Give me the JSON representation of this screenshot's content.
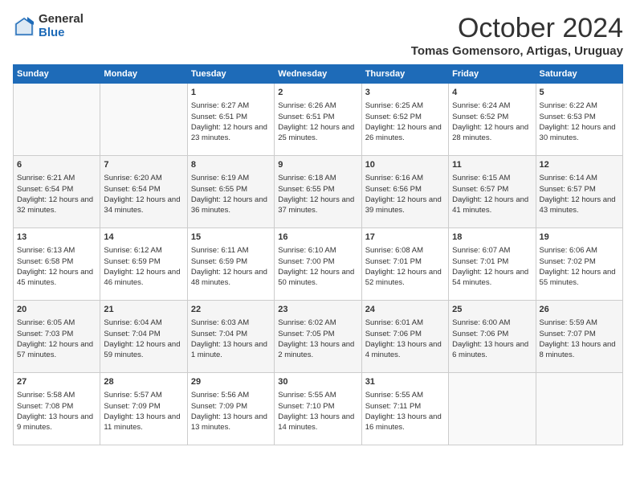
{
  "logo": {
    "general": "General",
    "blue": "Blue"
  },
  "title": "October 2024",
  "location": "Tomas Gomensoro, Artigas, Uruguay",
  "headers": [
    "Sunday",
    "Monday",
    "Tuesday",
    "Wednesday",
    "Thursday",
    "Friday",
    "Saturday"
  ],
  "weeks": [
    [
      {
        "day": "",
        "content": ""
      },
      {
        "day": "",
        "content": ""
      },
      {
        "day": "1",
        "content": "Sunrise: 6:27 AM\nSunset: 6:51 PM\nDaylight: 12 hours and 23 minutes."
      },
      {
        "day": "2",
        "content": "Sunrise: 6:26 AM\nSunset: 6:51 PM\nDaylight: 12 hours and 25 minutes."
      },
      {
        "day": "3",
        "content": "Sunrise: 6:25 AM\nSunset: 6:52 PM\nDaylight: 12 hours and 26 minutes."
      },
      {
        "day": "4",
        "content": "Sunrise: 6:24 AM\nSunset: 6:52 PM\nDaylight: 12 hours and 28 minutes."
      },
      {
        "day": "5",
        "content": "Sunrise: 6:22 AM\nSunset: 6:53 PM\nDaylight: 12 hours and 30 minutes."
      }
    ],
    [
      {
        "day": "6",
        "content": "Sunrise: 6:21 AM\nSunset: 6:54 PM\nDaylight: 12 hours and 32 minutes."
      },
      {
        "day": "7",
        "content": "Sunrise: 6:20 AM\nSunset: 6:54 PM\nDaylight: 12 hours and 34 minutes."
      },
      {
        "day": "8",
        "content": "Sunrise: 6:19 AM\nSunset: 6:55 PM\nDaylight: 12 hours and 36 minutes."
      },
      {
        "day": "9",
        "content": "Sunrise: 6:18 AM\nSunset: 6:55 PM\nDaylight: 12 hours and 37 minutes."
      },
      {
        "day": "10",
        "content": "Sunrise: 6:16 AM\nSunset: 6:56 PM\nDaylight: 12 hours and 39 minutes."
      },
      {
        "day": "11",
        "content": "Sunrise: 6:15 AM\nSunset: 6:57 PM\nDaylight: 12 hours and 41 minutes."
      },
      {
        "day": "12",
        "content": "Sunrise: 6:14 AM\nSunset: 6:57 PM\nDaylight: 12 hours and 43 minutes."
      }
    ],
    [
      {
        "day": "13",
        "content": "Sunrise: 6:13 AM\nSunset: 6:58 PM\nDaylight: 12 hours and 45 minutes."
      },
      {
        "day": "14",
        "content": "Sunrise: 6:12 AM\nSunset: 6:59 PM\nDaylight: 12 hours and 46 minutes."
      },
      {
        "day": "15",
        "content": "Sunrise: 6:11 AM\nSunset: 6:59 PM\nDaylight: 12 hours and 48 minutes."
      },
      {
        "day": "16",
        "content": "Sunrise: 6:10 AM\nSunset: 7:00 PM\nDaylight: 12 hours and 50 minutes."
      },
      {
        "day": "17",
        "content": "Sunrise: 6:08 AM\nSunset: 7:01 PM\nDaylight: 12 hours and 52 minutes."
      },
      {
        "day": "18",
        "content": "Sunrise: 6:07 AM\nSunset: 7:01 PM\nDaylight: 12 hours and 54 minutes."
      },
      {
        "day": "19",
        "content": "Sunrise: 6:06 AM\nSunset: 7:02 PM\nDaylight: 12 hours and 55 minutes."
      }
    ],
    [
      {
        "day": "20",
        "content": "Sunrise: 6:05 AM\nSunset: 7:03 PM\nDaylight: 12 hours and 57 minutes."
      },
      {
        "day": "21",
        "content": "Sunrise: 6:04 AM\nSunset: 7:04 PM\nDaylight: 12 hours and 59 minutes."
      },
      {
        "day": "22",
        "content": "Sunrise: 6:03 AM\nSunset: 7:04 PM\nDaylight: 13 hours and 1 minute."
      },
      {
        "day": "23",
        "content": "Sunrise: 6:02 AM\nSunset: 7:05 PM\nDaylight: 13 hours and 2 minutes."
      },
      {
        "day": "24",
        "content": "Sunrise: 6:01 AM\nSunset: 7:06 PM\nDaylight: 13 hours and 4 minutes."
      },
      {
        "day": "25",
        "content": "Sunrise: 6:00 AM\nSunset: 7:06 PM\nDaylight: 13 hours and 6 minutes."
      },
      {
        "day": "26",
        "content": "Sunrise: 5:59 AM\nSunset: 7:07 PM\nDaylight: 13 hours and 8 minutes."
      }
    ],
    [
      {
        "day": "27",
        "content": "Sunrise: 5:58 AM\nSunset: 7:08 PM\nDaylight: 13 hours and 9 minutes."
      },
      {
        "day": "28",
        "content": "Sunrise: 5:57 AM\nSunset: 7:09 PM\nDaylight: 13 hours and 11 minutes."
      },
      {
        "day": "29",
        "content": "Sunrise: 5:56 AM\nSunset: 7:09 PM\nDaylight: 13 hours and 13 minutes."
      },
      {
        "day": "30",
        "content": "Sunrise: 5:55 AM\nSunset: 7:10 PM\nDaylight: 13 hours and 14 minutes."
      },
      {
        "day": "31",
        "content": "Sunrise: 5:55 AM\nSunset: 7:11 PM\nDaylight: 13 hours and 16 minutes."
      },
      {
        "day": "",
        "content": ""
      },
      {
        "day": "",
        "content": ""
      }
    ]
  ]
}
